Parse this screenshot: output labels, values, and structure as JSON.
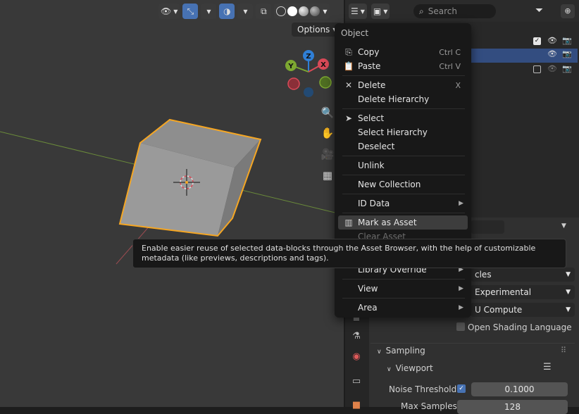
{
  "viewport": {
    "options_label": "Options",
    "header_icons": [
      "eye-icon",
      "move-gizmo-icon",
      "overlay-icon",
      "xray-icon",
      "wireframe-shading-icon",
      "solid-shading-icon",
      "material-shading-icon",
      "rendered-shading-icon"
    ],
    "gizmo": {
      "z": "Z",
      "y": "Y",
      "x": "X"
    }
  },
  "right_panel": {
    "search_placeholder": "Search",
    "properties": {
      "row1_value": "cles",
      "feature_set": "Experimental",
      "device": "U Compute",
      "osl_label": "Open Shading Language",
      "sampling_label": "Sampling",
      "viewport_label": "Viewport",
      "noise_threshold_label": "Noise Threshold",
      "noise_threshold_value": "0.1000",
      "max_samples_label": "Max Samples",
      "max_samples_value": "128"
    }
  },
  "menu": {
    "title": "Object",
    "items": [
      {
        "icon": "copy-icon",
        "label": "Copy",
        "shortcut": "Ctrl C"
      },
      {
        "icon": "paste-icon",
        "label": "Paste",
        "shortcut": "Ctrl V"
      },
      {
        "icon": "delete-icon",
        "label": "Delete",
        "shortcut": "X"
      },
      {
        "icon": "",
        "label": "Delete Hierarchy",
        "shortcut": ""
      },
      {
        "icon": "cursor-icon",
        "label": "Select",
        "shortcut": ""
      },
      {
        "icon": "",
        "label": "Select Hierarchy",
        "shortcut": ""
      },
      {
        "icon": "",
        "label": "Deselect",
        "shortcut": ""
      },
      {
        "icon": "",
        "label": "Unlink",
        "shortcut": ""
      },
      {
        "icon": "",
        "label": "New Collection",
        "shortcut": ""
      },
      {
        "icon": "",
        "label": "ID Data",
        "shortcut": "",
        "submenu": true
      },
      {
        "icon": "asset-icon",
        "label": "Mark as Asset",
        "shortcut": "",
        "highlighted": true
      },
      {
        "icon": "",
        "label": "Clear Asset",
        "shortcut": "",
        "disabled": true
      },
      {
        "icon": "",
        "label": "Library Override",
        "shortcut": "",
        "submenu": true
      },
      {
        "icon": "",
        "label": "View",
        "shortcut": "",
        "submenu": true
      },
      {
        "icon": "",
        "label": "Area",
        "shortcut": "",
        "submenu": true
      }
    ]
  },
  "tooltip": {
    "text": "Enable easier reuse of selected data-blocks through the Asset Browser, with the help of customizable metadata (like previews, descriptions and tags)."
  },
  "colors": {
    "viewport_bg": "#393939",
    "menu_bg": "#181818",
    "selection_orange": "#f5a623",
    "active_blue": "#4772b3",
    "axis_red": "#d94a58",
    "axis_green": "#7da831",
    "axis_blue": "#2f7fd6"
  }
}
